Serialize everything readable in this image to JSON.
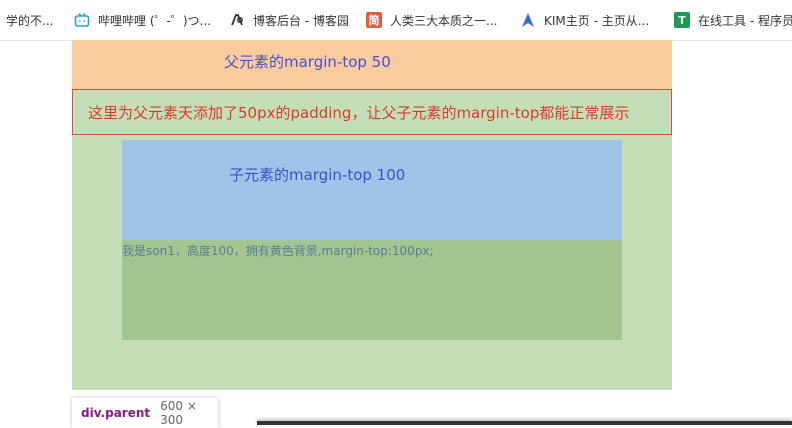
{
  "bookmarks": [
    {
      "label": "学的不...",
      "icon": "page-icon"
    },
    {
      "label": "哔哩哔哩 (゜-゜)つ...",
      "icon": "bilibili-tv-icon"
    },
    {
      "label": "博客后台 - 博客园",
      "icon": "cnblogs-icon"
    },
    {
      "label": "人类三大本质之一...",
      "icon": "jianshu-icon"
    },
    {
      "label": "KIM主页 - 主页从...",
      "icon": "arrow-up-icon"
    },
    {
      "label": "在线工具 - 程序员",
      "icon": "tool-t-icon"
    }
  ],
  "parent": {
    "margin_label": "父元素的margin-top 50",
    "padding_note": "这里为父元素天添加了50px的padding，让父子元素的margin-top都能正常展示"
  },
  "son": {
    "margin_label": "子元素的margin-top 100",
    "text": "我是son1，高度100，拥有黄色背景,margin-top:100px;"
  },
  "tooltip": {
    "tag": "div.parent",
    "dims": "600 × 300"
  },
  "colors": {
    "parent_bg": "#c4dfb8",
    "margin_highlight": "#f9cc9d",
    "son_margin_highlight": "#a0c4e8",
    "son_bg": "#a3c58f",
    "note_border": "#e04a3f"
  }
}
